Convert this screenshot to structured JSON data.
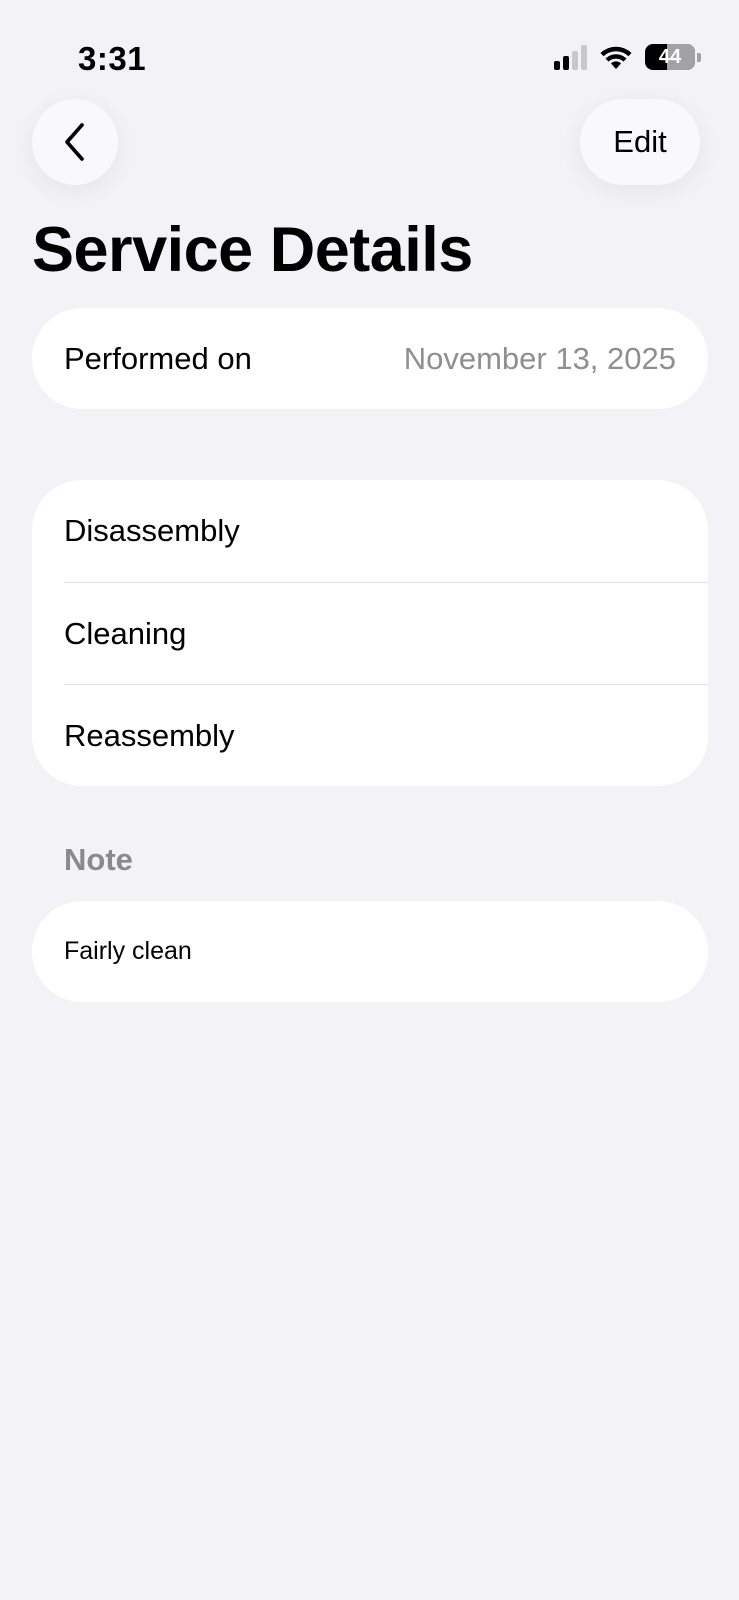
{
  "status_bar": {
    "time": "3:31",
    "battery_level": "44",
    "icons": [
      "cellular-signal-icon",
      "wifi-icon",
      "battery-icon"
    ]
  },
  "navigation": {
    "back_icon": "chevron-left-icon",
    "edit_label": "Edit"
  },
  "page": {
    "title": "Service Details"
  },
  "performed": {
    "label": "Performed on",
    "value": "November 13, 2025"
  },
  "steps": [
    {
      "label": "Disassembly"
    },
    {
      "label": "Cleaning"
    },
    {
      "label": "Reassembly"
    }
  ],
  "note": {
    "section_label": "Note",
    "text": "Fairly clean"
  },
  "colors": {
    "background": "#f2f2f7",
    "card": "#ffffff",
    "secondary_text": "#8e8e93",
    "section_header": "#8a8a8e"
  }
}
